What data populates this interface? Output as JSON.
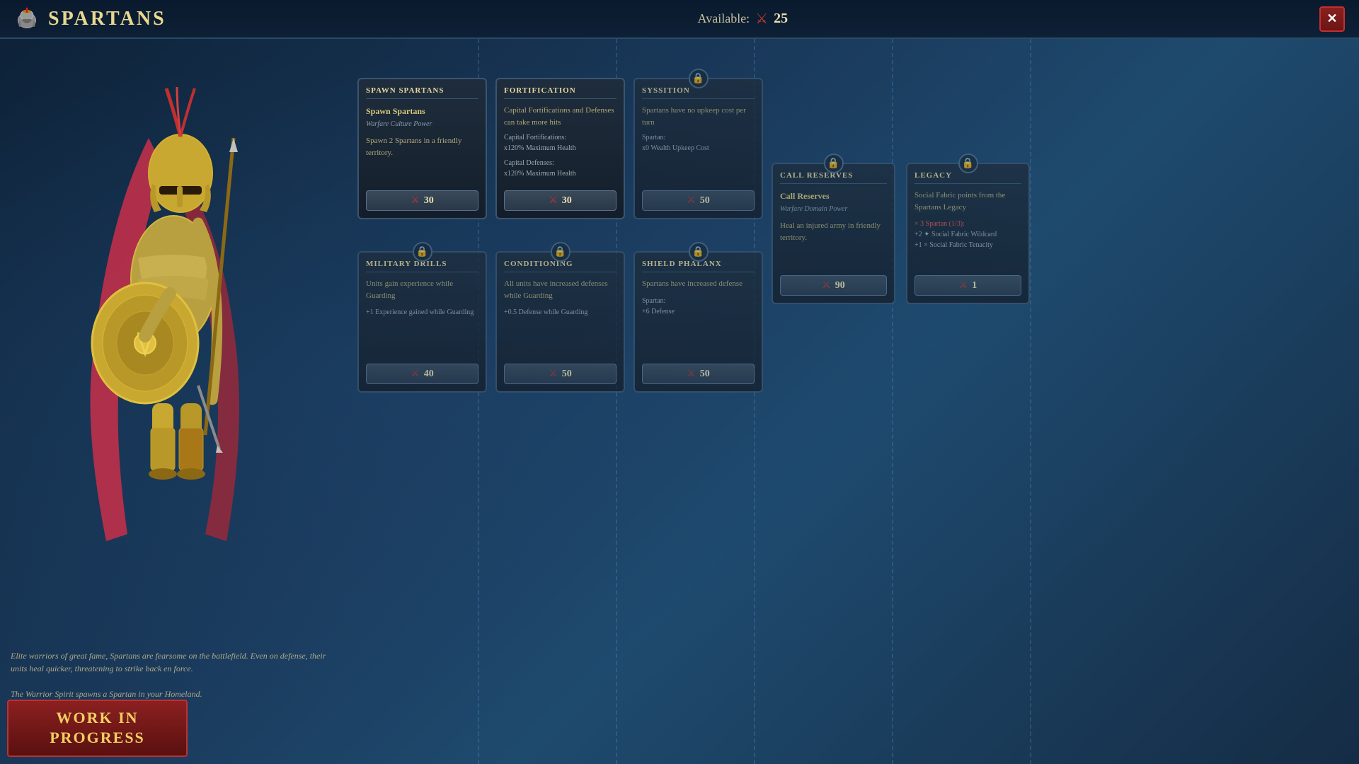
{
  "header": {
    "faction_icon": "⛨",
    "faction_title": "Spartans",
    "available_label": "Available:",
    "currency_icon": "⚔",
    "available_count": "25",
    "close_label": "✕"
  },
  "warrior": {
    "description": "Elite warriors of great fame, Spartans are fearsome on the battlefield. Even on defense, their units heal quicker, threatening to strike back en force.",
    "description2": "The Warrior Spirit spawns a Spartan in your Homeland."
  },
  "work_in_progress": {
    "label": "Work In\nProgress"
  },
  "cards": {
    "spawn_spartans": {
      "title": "Spawn Spartans",
      "name": "Spawn Spartans",
      "subtitle": "Warfare Culture Power",
      "desc": "Spawn 2 Spartans in a friendly territory.",
      "cost": "30"
    },
    "fortification": {
      "title": "Fortification",
      "name": "Capital Fortifications and Defenses can take more hits",
      "stat1_label": "Capital Fortifications:",
      "stat1_val": "x120% Maximum Health",
      "stat2_label": "Capital Defenses:",
      "stat2_val": "x120% Maximum Health",
      "cost": "30"
    },
    "syssition": {
      "title": "Syssition",
      "name": "Spartans have no upkeep cost per turn",
      "stat1_label": "Spartan:",
      "stat1_val": "x0 Wealth Upkeep Cost",
      "cost": "50",
      "locked": true
    },
    "military_drills": {
      "title": "Military Drills",
      "name": "Units gain experience while Guarding",
      "stat1_val": "+1 Experience gained while Guarding",
      "cost": "40",
      "locked": true
    },
    "conditioning": {
      "title": "Conditioning",
      "name": "All units have increased defenses while Guarding",
      "stat1_val": "+0.5 Defense while Guarding",
      "cost": "50",
      "locked": true
    },
    "shield_phalanx": {
      "title": "Shield Phalanx",
      "name": "Spartans have increased defense",
      "stat1_label": "Spartan:",
      "stat1_val": "+6 Defense",
      "cost": "50",
      "locked": true
    },
    "call_reserves": {
      "title": "Call Reserves",
      "name": "Call Reserves",
      "subtitle": "Warfare Domain Power",
      "desc": "Heal an injured army in friendly territory.",
      "cost": "90",
      "locked": true
    },
    "legacy": {
      "title": "Legacy",
      "name": "Social Fabric points from the Spartans Legacy",
      "stat1": "× 3 Spartan (1/3):",
      "stat2": "+2 ✦ Social Fabric Wildcard",
      "stat3": "+1 × Social Fabric Tenacity",
      "cost": "1",
      "locked": true
    }
  }
}
